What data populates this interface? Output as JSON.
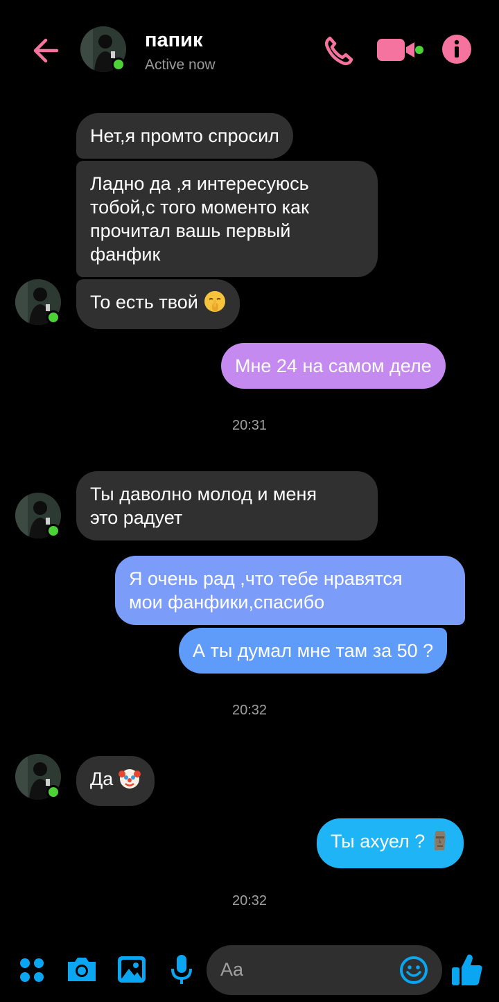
{
  "header": {
    "contact_name": "папик",
    "status": "Active now"
  },
  "colors": {
    "accent_pink": "#f4739f",
    "accent_blue": "#0aa6f2",
    "online_green": "#4cd137",
    "incoming_bubble": "#303030"
  },
  "icons": {
    "back": "arrow-left-icon",
    "call": "phone-icon",
    "video": "video-camera-icon",
    "info": "info-icon",
    "menu": "four-dots-icon",
    "camera": "camera-icon",
    "gallery": "image-icon",
    "voice": "microphone-icon",
    "emoji": "smiley-icon",
    "like": "thumbs-up-icon"
  },
  "messages": [
    {
      "text": "Нет,я промто спросил"
    },
    {
      "lines": [
        "Ладно да ,я интересуюсь",
        "тобой,с того моменто как",
        "прочитал вашь первый",
        "фанфик"
      ]
    },
    {
      "text": "То есть твой"
    },
    {
      "text": "Мне 24 на самом деле"
    },
    {
      "lines": [
        "Ты даволно молод и меня",
        "это радует"
      ]
    },
    {
      "lines": [
        "Я очень рад ,что тебе нравятся",
        "мои фанфики,спасибо"
      ]
    },
    {
      "text": "А ты думал мне там за 50 ?"
    },
    {
      "text": "Да"
    },
    {
      "text": "Ты ахуел ?"
    }
  ],
  "timestamps": [
    "20:31",
    "20:32",
    "20:32"
  ],
  "composer": {
    "placeholder": "Aa"
  }
}
